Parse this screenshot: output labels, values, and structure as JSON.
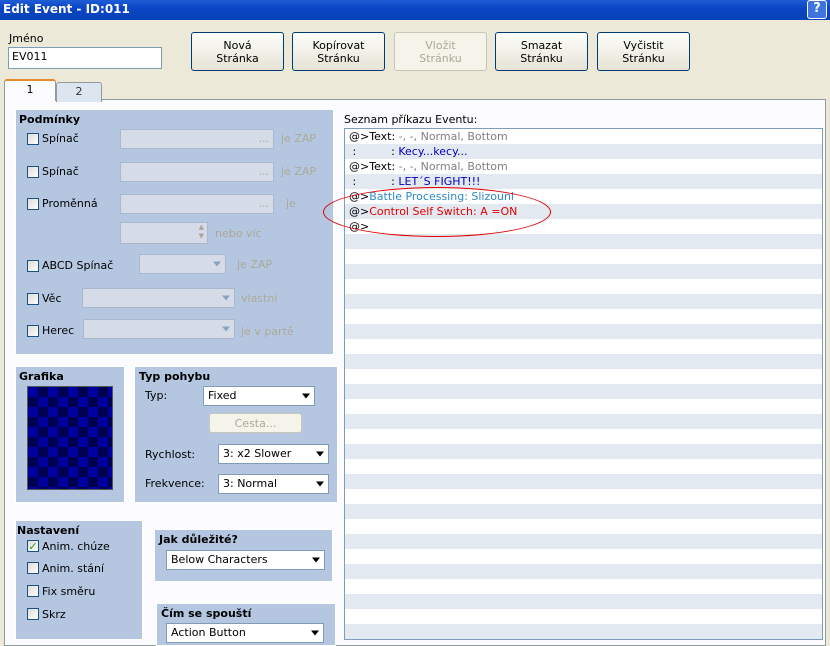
{
  "window": {
    "title": "Edit Event - ID:011",
    "help": "?"
  },
  "name": {
    "label": "Jméno",
    "value": "EV011"
  },
  "page_buttons": {
    "new": [
      "Nová",
      "Stránka"
    ],
    "copy": [
      "Kopírovat",
      "Stránku"
    ],
    "paste": [
      "Vložit",
      "Stránku"
    ],
    "delete": [
      "Smazat",
      "Stránku"
    ],
    "clear": [
      "Vyčistit",
      "Stránku"
    ]
  },
  "tabs": [
    "1",
    "2"
  ],
  "conditions": {
    "title": "Podmínky",
    "switch1": {
      "label": "Spínač",
      "suffix": "je ZAP",
      "dots": "..."
    },
    "switch2": {
      "label": "Spínač",
      "suffix": "je ZAP",
      "dots": "..."
    },
    "variable": {
      "label": "Proměnná",
      "suffix": "je",
      "dots": "...",
      "or_more": "nebo víc"
    },
    "self_switch": {
      "label": "ABCD Spínač",
      "suffix": "je ZAP"
    },
    "item": {
      "label": "Věc",
      "suffix": "vlastní"
    },
    "actor": {
      "label": "Herec",
      "suffix": "je v partě"
    }
  },
  "graphic": {
    "title": "Grafika"
  },
  "movement": {
    "title": "Typ pohybu",
    "type_label": "Typ:",
    "type_value": "Fixed",
    "route_button": "Cesta...",
    "speed_label": "Rychlost:",
    "speed_value": "3: x2 Slower",
    "freq_label": "Frekvence:",
    "freq_value": "3: Normal"
  },
  "options": {
    "title": "Nastavení",
    "items": [
      {
        "label": "Anim. chúze",
        "checked": true
      },
      {
        "label": "Anim. stání",
        "checked": false
      },
      {
        "label": "Fix směru",
        "checked": false
      },
      {
        "label": "Skrz",
        "checked": false
      }
    ]
  },
  "priority": {
    "title": "Jak důležité?",
    "value": "Below Characters"
  },
  "trigger": {
    "title": "Čím se spouští",
    "value": "Action Button"
  },
  "commands": {
    "title": "Seznam příkazu Eventu:",
    "rows": [
      {
        "prefix": "@>Text: ",
        "text": "-, -, Normal, Bottom",
        "style": "gray"
      },
      {
        "prefix": " :          : ",
        "text": "Kecy...kecy...",
        "style": "navy"
      },
      {
        "prefix": "@>Text: ",
        "text": "-, -, Normal, Bottom",
        "style": "gray"
      },
      {
        "prefix": " :          : ",
        "text": "LET´S FIGHT!!!",
        "style": "navy"
      },
      {
        "prefix": "@>",
        "text": "Battle Processing: Slizouni",
        "style": "teal"
      },
      {
        "prefix": "@>",
        "text": "Control Self Switch: A =ON",
        "style": "red"
      },
      {
        "prefix": "@>",
        "text": "",
        "style": "gray"
      }
    ]
  },
  "colors": {
    "titlebar": "#0a45c5",
    "group_bg": "#b5c7e0",
    "annotation": "#e00000"
  }
}
